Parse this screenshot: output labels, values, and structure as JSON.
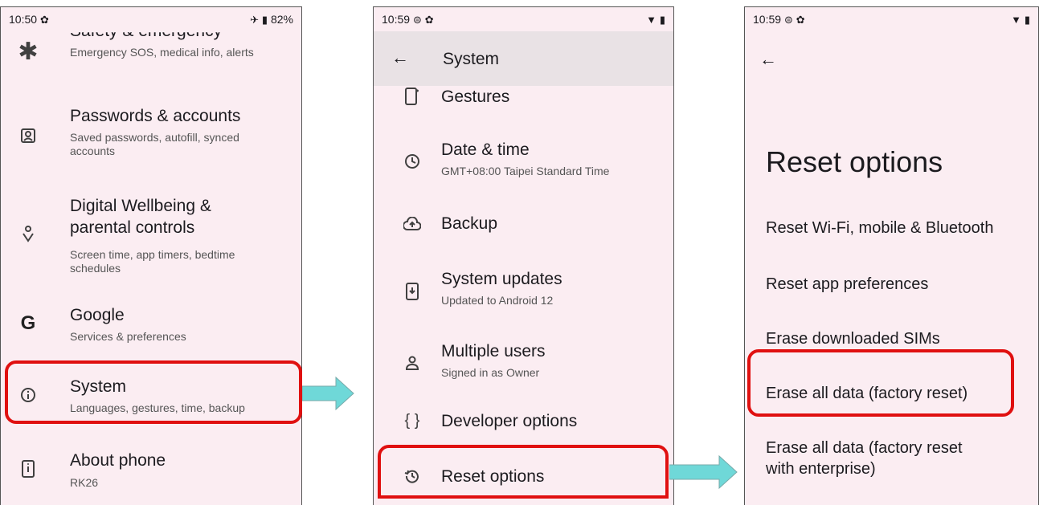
{
  "phone1": {
    "status": {
      "time": "10:50",
      "battery": "82%"
    },
    "items": [
      {
        "title": "Safety & emergency",
        "subtitle": "Emergency SOS, medical info, alerts",
        "icon": "asterisk-icon"
      },
      {
        "title": "Passwords & accounts",
        "subtitle": "Saved passwords, autofill, synced accounts",
        "icon": "account-box-icon"
      },
      {
        "title": "Digital Wellbeing & parental controls",
        "title_l1": "Digital Wellbeing &",
        "title_l2": "parental controls",
        "subtitle": "Screen time, app timers, bedtime schedules",
        "icon": "wellbeing-icon"
      },
      {
        "title": "Google",
        "subtitle": "Services & preferences",
        "icon": "google-icon"
      },
      {
        "title": "System",
        "subtitle": "Languages, gestures, time, backup",
        "icon": "info-icon"
      },
      {
        "title": "About phone",
        "subtitle": "RK26",
        "icon": "phone-icon"
      }
    ]
  },
  "phone2": {
    "status": {
      "time": "10:59"
    },
    "toolbar_title": "System",
    "items": [
      {
        "title": "Gestures",
        "icon": "gestures-icon"
      },
      {
        "title": "Date & time",
        "subtitle": "GMT+08:00 Taipei Standard Time",
        "icon": "clock-icon"
      },
      {
        "title": "Backup",
        "icon": "cloud-upload-icon"
      },
      {
        "title": "System updates",
        "subtitle": "Updated to Android 12",
        "icon": "system-update-icon"
      },
      {
        "title": "Multiple users",
        "subtitle": "Signed in as Owner",
        "icon": "person-icon"
      },
      {
        "title": "Developer options",
        "icon": "braces-icon"
      },
      {
        "title": "Reset options",
        "icon": "history-icon"
      }
    ]
  },
  "phone3": {
    "status": {
      "time": "10:59"
    },
    "heading": "Reset options",
    "options": [
      "Reset Wi-Fi, mobile & Bluetooth",
      "Reset app preferences",
      "Erase downloaded SIMs",
      "Erase all data (factory reset)",
      "Erase all data (factory reset with enterprise)"
    ],
    "last_option_l1": "Erase all data (factory reset",
    "last_option_l2": "with enterprise)"
  },
  "colors": {
    "highlight": "#e01010",
    "arrow": "#6fd8d8",
    "screen_bg": "#fbedf2"
  }
}
